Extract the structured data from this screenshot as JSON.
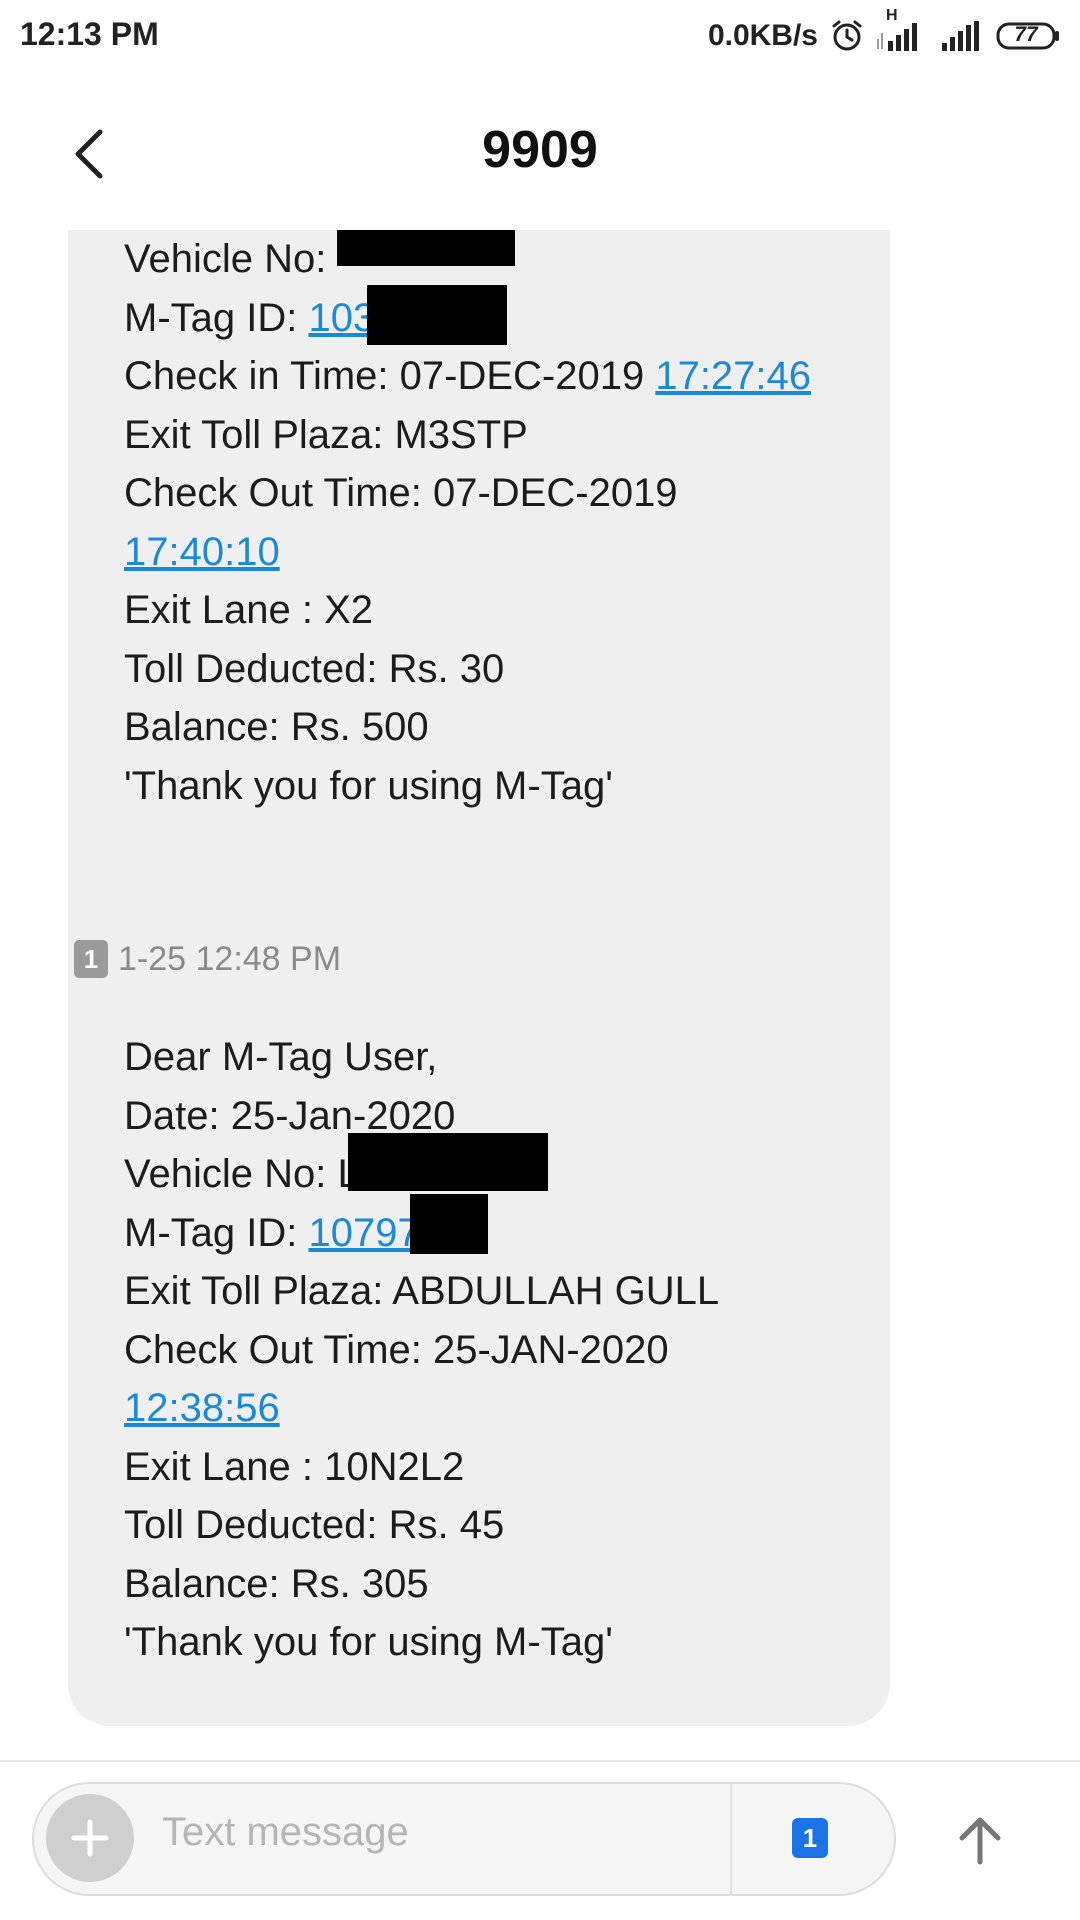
{
  "status_bar": {
    "time": "12:13 PM",
    "net_speed": "0.0KB/s",
    "network_type": "H",
    "battery": "77",
    "icons": [
      "alarm-icon",
      "signal-icon",
      "signal-icon",
      "battery-icon"
    ]
  },
  "header": {
    "title": "9909",
    "back_icon": "chevron-left-icon"
  },
  "messages": [
    {
      "lines": [
        {
          "label": "Vehicle No: ",
          "value": "",
          "redacted": true
        },
        {
          "label": "M-Tag ID: ",
          "link": "103"
        },
        {
          "label": "Check in Time: 07-DEC-2019 ",
          "link": "17:27:46"
        },
        {
          "text": "Exit Toll Plaza: M3STP"
        },
        {
          "text": "Check Out Time: 07-DEC-2019"
        },
        {
          "link": "17:40:10"
        },
        {
          "text": "Exit Lane : X2"
        },
        {
          "text": "Toll Deducted: Rs. 30"
        },
        {
          "text": "Balance: Rs. 500"
        },
        {
          "text": "'Thank you for using M-Tag'"
        }
      ]
    },
    {
      "timestamp": "1-25 12:48 PM",
      "sim": "1",
      "lines": [
        {
          "text": "Dear M-Tag User,"
        },
        {
          "text": "Date: 25-Jan-2020"
        },
        {
          "label": "Vehicle No: ",
          "value": "L",
          "redacted": true
        },
        {
          "label": "M-Tag ID: ",
          "link": "10797"
        },
        {
          "text": "Exit Toll Plaza: ABDULLAH GULL"
        },
        {
          "text": "Check Out Time: 25-JAN-2020"
        },
        {
          "link": "12:38:56"
        },
        {
          "text": "Exit Lane : 10N2L2"
        },
        {
          "text": "Toll Deducted: Rs. 45"
        },
        {
          "text": "Balance: Rs. 305"
        },
        {
          "text": "'Thank you for using M-Tag'"
        }
      ]
    }
  ],
  "compose": {
    "placeholder": "Text message",
    "sim": "1",
    "add_icon": "plus-icon",
    "send_icon": "arrow-up-icon"
  },
  "colors": {
    "link": "#1a8ad6",
    "bubble": "#efefef",
    "sim_badge": "#1b73e8"
  }
}
